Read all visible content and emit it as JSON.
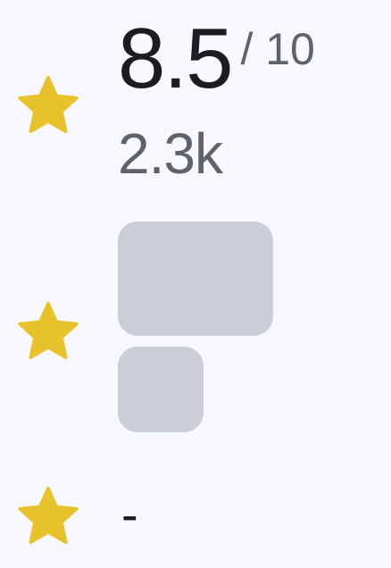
{
  "colors": {
    "background": "#f7f8fd",
    "star": "#e8c22a",
    "skeleton": "#cbced5",
    "primary_text": "#1b1d22",
    "secondary_text": "#5f6268"
  },
  "rating_row": {
    "icon": "star-icon",
    "score": "8.5",
    "max_label": "/ 10",
    "vote_count": "2.3k"
  },
  "loading_row": {
    "icon": "star-icon"
  },
  "empty_row": {
    "icon": "star-icon",
    "placeholder": "-"
  }
}
